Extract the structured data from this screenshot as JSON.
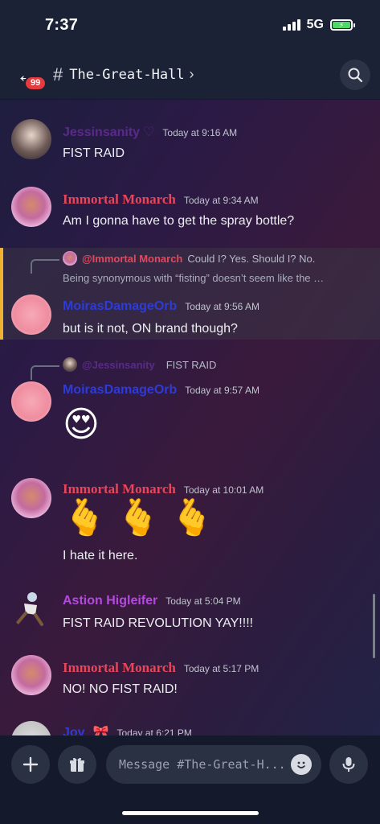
{
  "status_bar": {
    "time": "7:37",
    "network": "5G"
  },
  "header": {
    "badge": "99",
    "channel": "The-Great-Hall"
  },
  "messages": [
    {
      "author": "Jessinsanity",
      "heart": "♡",
      "time": "Today at 9:16 AM",
      "text": "FIST RAID",
      "color": "#5a2a8a"
    },
    {
      "author": "Immortal Monarch",
      "time": "Today at 9:34 AM",
      "text": "Am I gonna have to get the spray bottle?",
      "color": "#e8465a"
    },
    {
      "reply_to": "@Immortal Monarch",
      "reply_text": "Could I? Yes. Should I? No.",
      "reply_text_cont": "Being synonymous with “fisting” doesn’t seem like the …",
      "author": "MoirasDamageOrb",
      "time": "Today at 9:56 AM",
      "text": "but is it not, ON brand though?",
      "color": "#2d3bd8"
    },
    {
      "reply_to": "@Jessinsanity",
      "reply_text": "FIST RAID",
      "author": "MoirasDamageOrb",
      "time": "Today at 9:57 AM",
      "emoji": "😍",
      "color": "#2d3bd8"
    },
    {
      "author": "Immortal Monarch",
      "time": "Today at 10:01 AM",
      "emoji": "🫰",
      "text": "I hate it here.",
      "color": "#e8465a"
    },
    {
      "author": "Astion Higleifer",
      "time": "Today at 5:04 PM",
      "text": "FIST RAID REVOLUTION YAY!!!!",
      "color": "#b44ae0"
    },
    {
      "author": "Immortal Monarch",
      "time": "Today at 5:17 PM",
      "text": "NO! NO FIST RAID!",
      "color": "#e8465a"
    },
    {
      "author": "Joy",
      "bow": "🎀",
      "time": "Today at 6:21 PM",
      "color": "#2d3bd8"
    }
  ],
  "composer": {
    "placeholder": "Message #The-Great-H..."
  },
  "icons": [
    "back-arrow-icon",
    "hash-icon",
    "chevron-right-icon",
    "search-icon",
    "plus-icon",
    "gift-icon",
    "smiley-icon",
    "microphone-icon"
  ]
}
